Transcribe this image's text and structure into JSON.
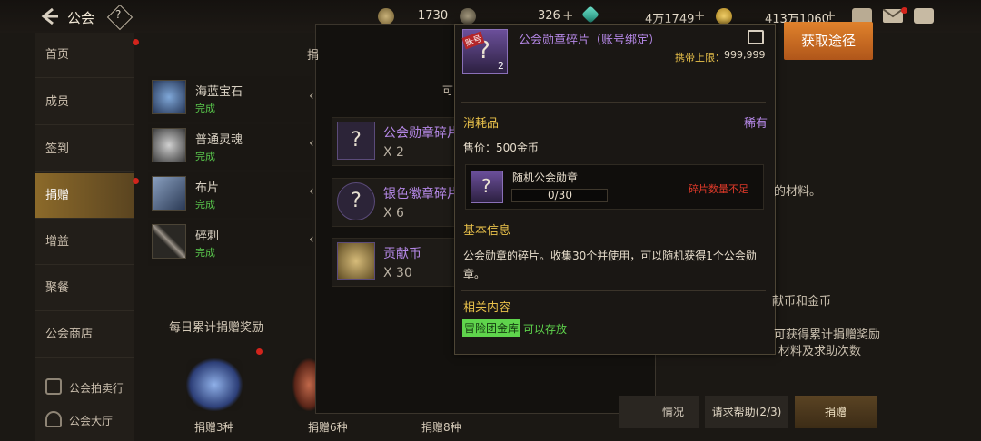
{
  "topbar": {
    "back_label": "公会",
    "help_symbol": "?",
    "resources": [
      {
        "icon": "stamina-icon",
        "value": "1730"
      },
      {
        "icon": "guild-coin-icon",
        "value": "326"
      },
      {
        "icon": "diamond-icon",
        "value": "4万1749"
      },
      {
        "icon": "gold-coin-icon",
        "value": "413万1060"
      }
    ],
    "plus_symbol": "+"
  },
  "sidebar": {
    "items": [
      {
        "label": "首页"
      },
      {
        "label": "成员"
      },
      {
        "label": "签到"
      },
      {
        "label": "捐赠"
      },
      {
        "label": "增益"
      },
      {
        "label": "聚餐"
      },
      {
        "label": "公会商店"
      }
    ],
    "bottom": [
      {
        "label": "公会拍卖行"
      },
      {
        "label": "公会大厅"
      }
    ]
  },
  "materials": [
    {
      "name": "海蓝宝石",
      "status": "完成",
      "icon": "sapphire-icon"
    },
    {
      "name": "普通灵魂",
      "status": "完成",
      "icon": "soul-icon"
    },
    {
      "name": "布片",
      "status": "完成",
      "icon": "cloth-icon"
    },
    {
      "name": "碎刺",
      "status": "完成",
      "icon": "thorn-icon"
    }
  ],
  "daily_reward": {
    "title": "每日累计捐赠奖励",
    "rewards": [
      {
        "label": "捐赠3种"
      },
      {
        "label": "捐赠6种"
      },
      {
        "label": "捐赠8种"
      }
    ]
  },
  "middle_panel": {
    "header_partial": "捐",
    "sub_partial": "可",
    "items": [
      {
        "name": "公会勋章碎片",
        "qty": "X 2"
      },
      {
        "name": "银色徽章碎片",
        "qty": "X 6"
      },
      {
        "name": "贡献币",
        "qty": "X 30"
      }
    ]
  },
  "tooltip": {
    "badge_text": "账号",
    "count": "2",
    "title": "公会勋章碎片（账号绑定）",
    "limit_label": "携带上限：",
    "limit_value": "999,999",
    "category": "消耗品",
    "rarity": "稀有",
    "price": "售价：500金币",
    "reward_name": "随机公会勋章",
    "reward_progress": "0/30",
    "reward_progress_value": 0,
    "insufficient": "碎片数量不足",
    "basic_info_title": "基本信息",
    "description": "公会勋章的碎片。收集30个并使用，可以随机获得1个公会勋章。",
    "related_title": "相关内容",
    "related_tag": "冒险团金库",
    "related_status": "可以存放"
  },
  "right_panel": {
    "get_button": "获取途径",
    "text1": "的材料。",
    "text2": "献币和金币",
    "text3": "可获得累计捐赠奖励",
    "text4": "材料及求助次数",
    "btn_status": "情况",
    "btn_help": "请求帮助(2/3)",
    "btn_donate": "捐赠"
  },
  "colors": {
    "accent_orange": "#d9782a",
    "rare_purple": "#b487e5",
    "complete_green": "#58c64b",
    "warning_red": "#e03a2a",
    "gold_text": "#e8c04a"
  }
}
